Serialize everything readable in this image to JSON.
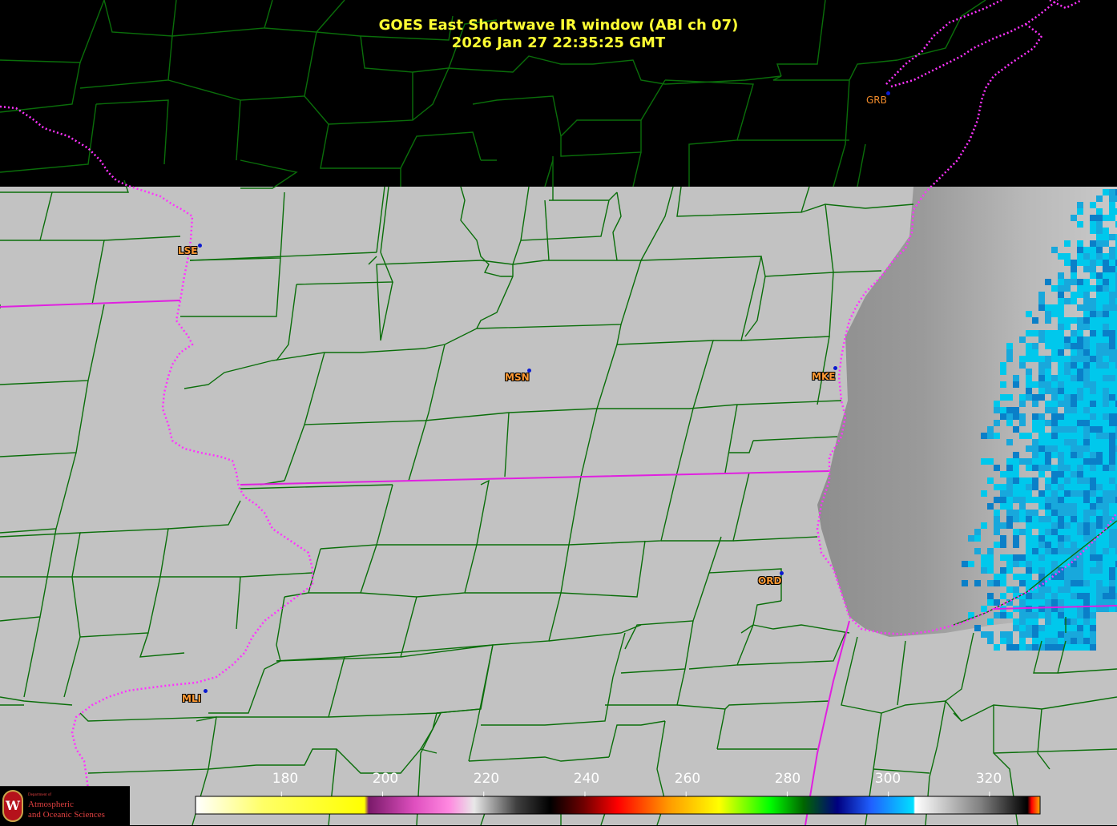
{
  "title": {
    "line1": "GOES East Shortwave IR window (ABI ch 07)",
    "line2": "2026 Jan 27  22:35:25 GMT"
  },
  "stations": [
    {
      "id": "GRB",
      "label": "GRB"
    },
    {
      "id": "LSE",
      "label": "LSE"
    },
    {
      "id": "MSN",
      "label": "MSN"
    },
    {
      "id": "MKE",
      "label": "MKE"
    },
    {
      "id": "ORD",
      "label": "ORD"
    },
    {
      "id": "MLI",
      "label": "MLI"
    }
  ],
  "colorbar": {
    "unit_values": [
      180,
      200,
      220,
      240,
      260,
      280,
      300,
      320
    ],
    "tick_labels": [
      "180",
      "200",
      "220",
      "240",
      "260",
      "280",
      "300",
      "320"
    ],
    "range": [
      163,
      330
    ]
  },
  "logo": {
    "dept_line": "Department of",
    "line1": "Atmospheric",
    "line2": "and Oceanic Sciences",
    "seal_letter": "W"
  },
  "colors": {
    "county_lines": "#0a6e0a",
    "state_lines": "#e020e0",
    "title": "#ffff33",
    "station_label": "#ff9933",
    "station_dot": "#0a1ad0",
    "ground": "#c2c2c2",
    "cloud_cyan": "#00c8ec"
  }
}
